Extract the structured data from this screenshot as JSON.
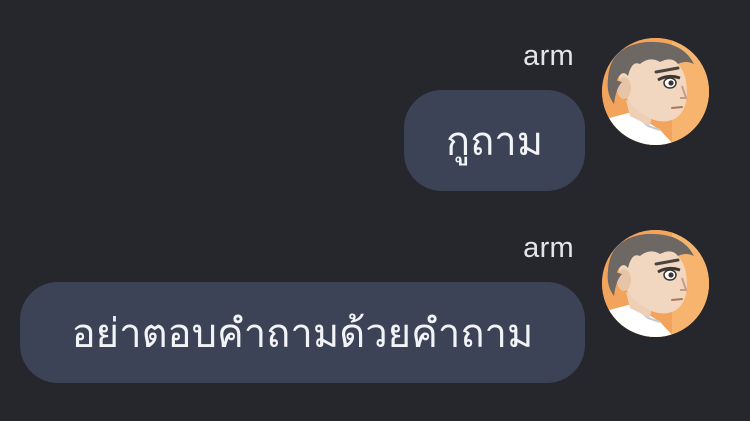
{
  "messages": [
    {
      "sender": "arm",
      "text": "กูถาม",
      "avatar_icon": "anime-boy-avatar-icon"
    },
    {
      "sender": "arm",
      "text": "อย่าตอบคำถามด้วยคำถาม",
      "avatar_icon": "anime-boy-avatar-icon"
    }
  ],
  "colors": {
    "background": "#26272c",
    "bubble": "#3d4356",
    "text": "#f2f3f6",
    "sender": "#e4e5ea"
  }
}
